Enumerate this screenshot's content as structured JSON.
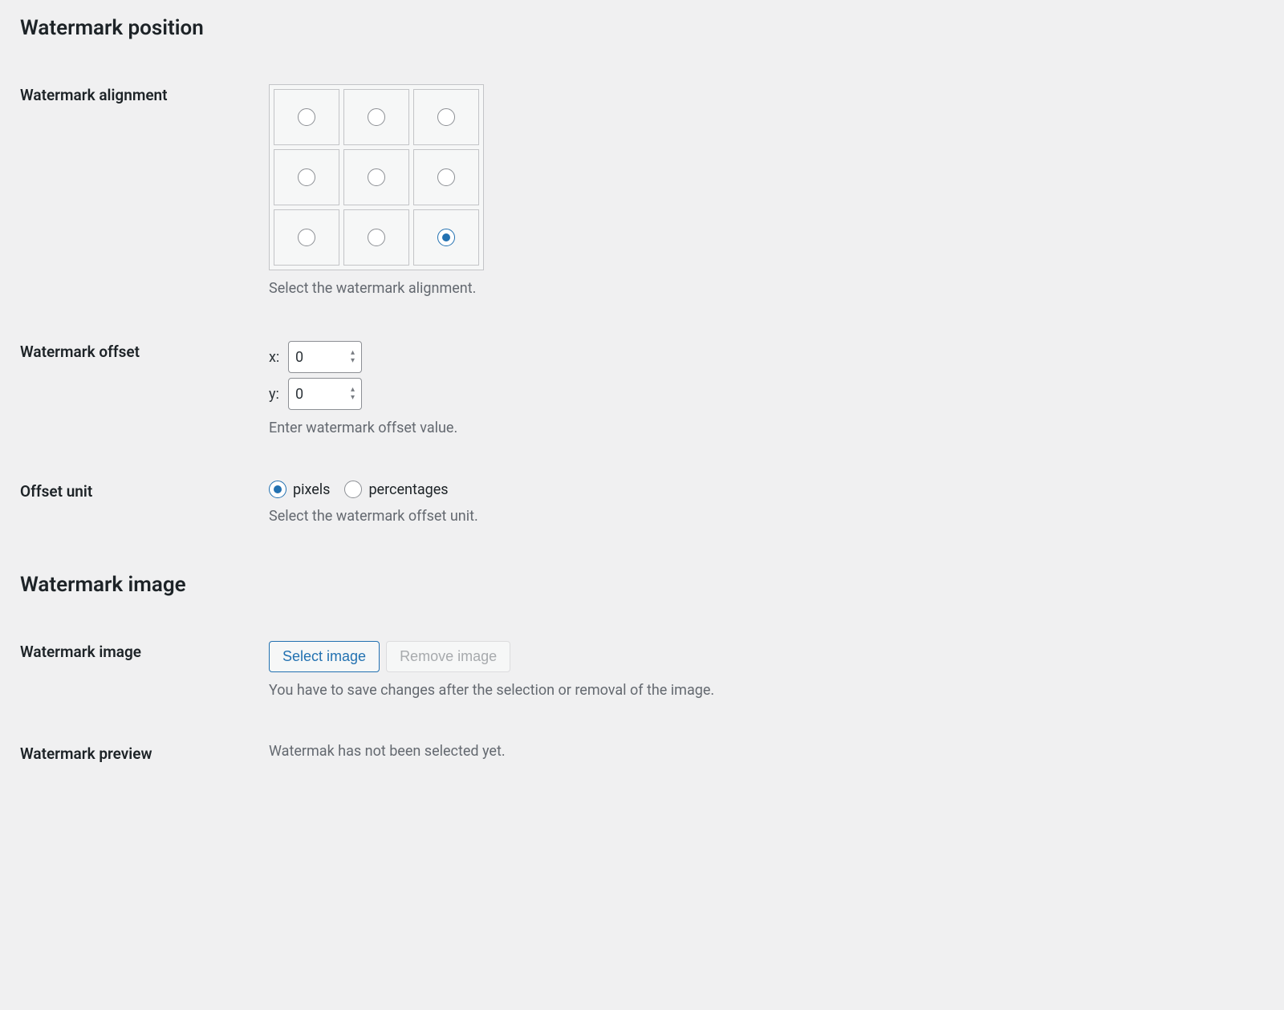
{
  "sections": {
    "position_title": "Watermark position",
    "image_title": "Watermark image"
  },
  "alignment": {
    "label": "Watermark alignment",
    "description": "Select the watermark alignment.",
    "selected_index": 8
  },
  "offset": {
    "label": "Watermark offset",
    "x_label": "x:",
    "y_label": "y:",
    "x_value": "0",
    "y_value": "0",
    "description": "Enter watermark offset value."
  },
  "unit": {
    "label": "Offset unit",
    "option_pixels": "pixels",
    "option_percentages": "percentages",
    "selected": "pixels",
    "description": "Select the watermark offset unit."
  },
  "image": {
    "label": "Watermark image",
    "select_button": "Select image",
    "remove_button": "Remove image",
    "description": "You have to save changes after the selection or removal of the image."
  },
  "preview": {
    "label": "Watermark preview",
    "text": "Watermak has not been selected yet."
  }
}
